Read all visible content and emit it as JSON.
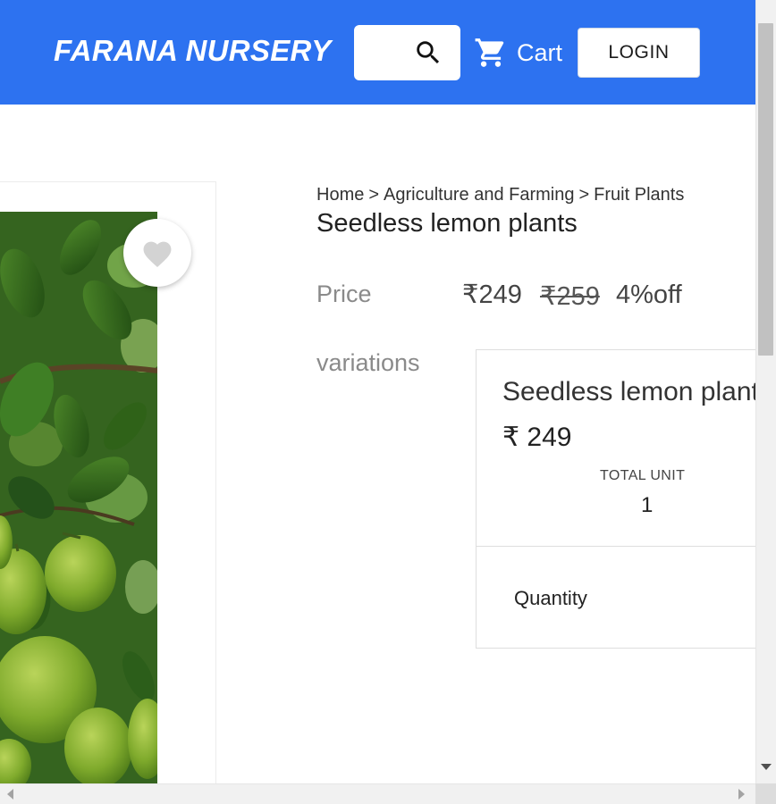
{
  "header": {
    "brand": "FARANA NURSERY",
    "search_icon": "search-icon",
    "cart_icon": "shopping-cart-icon",
    "cart_label": "Cart",
    "login_label": "LOGIN",
    "background_color": "#2d72f0"
  },
  "product": {
    "image": "lemon-plant-photo",
    "favorite_icon": "heart-icon",
    "breadcrumb": [
      "Home",
      "Agriculture and Farming",
      "Fruit Plants"
    ],
    "breadcrumb_separator": ">",
    "title": "Seedless lemon plants",
    "price_label": "Price",
    "price_current": "₹249",
    "price_old": "₹259",
    "discount": "4%off",
    "variations_label": "variations"
  },
  "variation": {
    "name": "Seedless lemon plants",
    "price": "₹ 249",
    "total_unit_label": "TOTAL UNIT",
    "total_unit_value": "1",
    "quantity_label": "Quantity"
  }
}
